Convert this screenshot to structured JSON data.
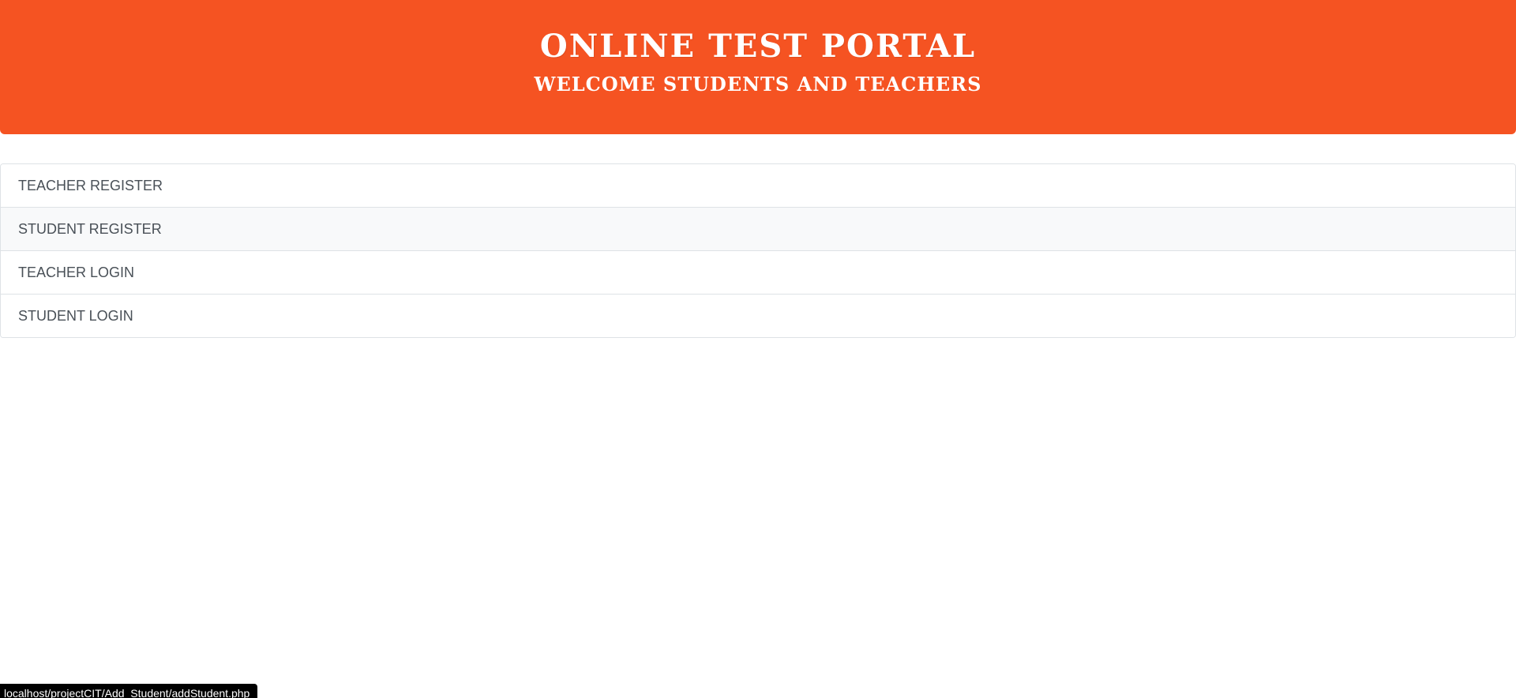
{
  "header": {
    "title": "ONLINE TEST PORTAL",
    "subtitle": "WELCOME STUDENTS AND TEACHERS",
    "background_color": "#f55322"
  },
  "menu": {
    "items": [
      {
        "label": "TEACHER REGISTER"
      },
      {
        "label": "STUDENT REGISTER"
      },
      {
        "label": "TEACHER LOGIN"
      },
      {
        "label": "STUDENT LOGIN"
      }
    ],
    "hovered_item": "STUDENT REGISTER"
  },
  "status_bar": {
    "url": "localhost/projectCIT/Add_Student/addStudent.php"
  }
}
